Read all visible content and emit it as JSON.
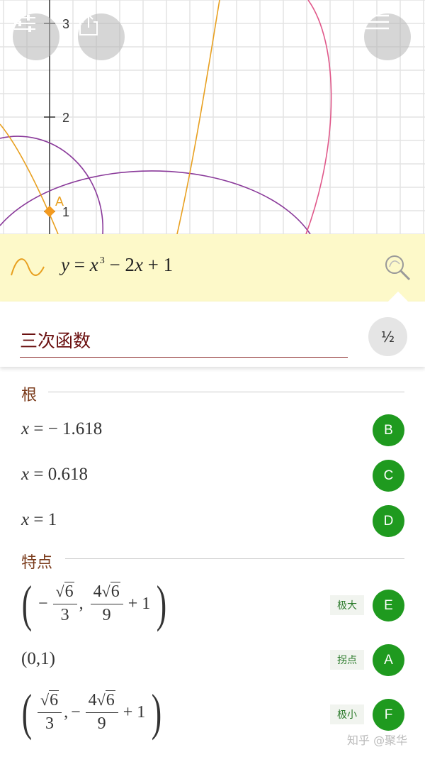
{
  "graph": {
    "y_tick_labels": [
      "3",
      "2",
      "1"
    ],
    "point_label": "A",
    "colors": {
      "cubic": "#e8a020",
      "circle": "#8a3a9a",
      "pink_curve": "#e0588a",
      "point": "#f39a1f",
      "grid": "#e3e3e3"
    }
  },
  "toolbar": {
    "settings_icon": "sliders-icon",
    "share_icon": "share-icon",
    "menu_icon": "menu-icon"
  },
  "input": {
    "formula_y": "y",
    "formula_eq": " = ",
    "formula_x": "x",
    "formula_exp": "3",
    "formula_rest_1": " − 2",
    "formula_x2": "x",
    "formula_rest_2": " + 1",
    "search_icon": "zoom-search-icon"
  },
  "panel": {
    "function_name": "三次函数",
    "fraction_toggle": "½",
    "roots_heading": "根",
    "roots": [
      {
        "var": "x",
        "rhs": " =  − 1.618",
        "point": "B"
      },
      {
        "var": "x",
        "rhs": " = 0.618",
        "point": "C"
      },
      {
        "var": "x",
        "rhs": " = 1",
        "point": "D"
      }
    ],
    "features_heading": "特点",
    "features": [
      {
        "tag": "极大",
        "point": "E"
      },
      {
        "expr": "(0,1)",
        "tag": "拐点",
        "point": "A"
      },
      {
        "tag": "极小",
        "point": "F"
      }
    ],
    "expr_parts": {
      "minus": "−",
      "sqrt6": "6",
      "three": "3",
      "comma": ",",
      "four": "4",
      "nine": "9",
      "plus1": "+ 1"
    }
  },
  "watermark": "知乎 @聚华"
}
